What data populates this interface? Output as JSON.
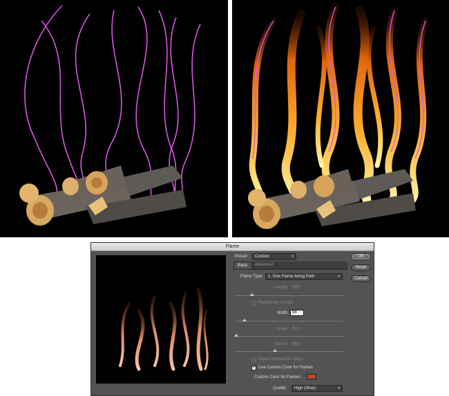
{
  "dialog": {
    "title": "Flame",
    "preset_label": "Preset:",
    "preset_value": "Custom",
    "tabs": [
      "Basic",
      "Advanced"
    ],
    "flame_type_label": "Flame Type:",
    "flame_type_value": "1. One Flame Along Path",
    "length_label": "Length:",
    "length_value": "187",
    "randomize_length_label": "Randomize Length",
    "width_label": "Width:",
    "width_value": "98",
    "angle_label": "Angle:",
    "angle_value": "0",
    "interval_label": "Interval:",
    "interval_value": "15",
    "adjust_interval_label": "Adjust Interval for Loops",
    "use_custom_color_label": "Use Custom Color for Flames",
    "custom_color_label": "Custom Color for Flames:",
    "custom_color": "#b64a2c",
    "quality_label": "Quality:",
    "quality_value": "High (Slow)",
    "ok_label": "OK",
    "reset_label": "Reset",
    "cancel_label": "Cancel",
    "checks": {
      "randomize_length": false,
      "adjust_interval": false,
      "use_custom_color": true
    },
    "sliders": {
      "length": 0.15,
      "width": 0.08,
      "angle": 0.0,
      "interval": 0.36
    }
  },
  "colors": {
    "path_magenta": "#d957e4",
    "flame_orange": "#f08a1c",
    "preview_flame": "#e08a64"
  }
}
